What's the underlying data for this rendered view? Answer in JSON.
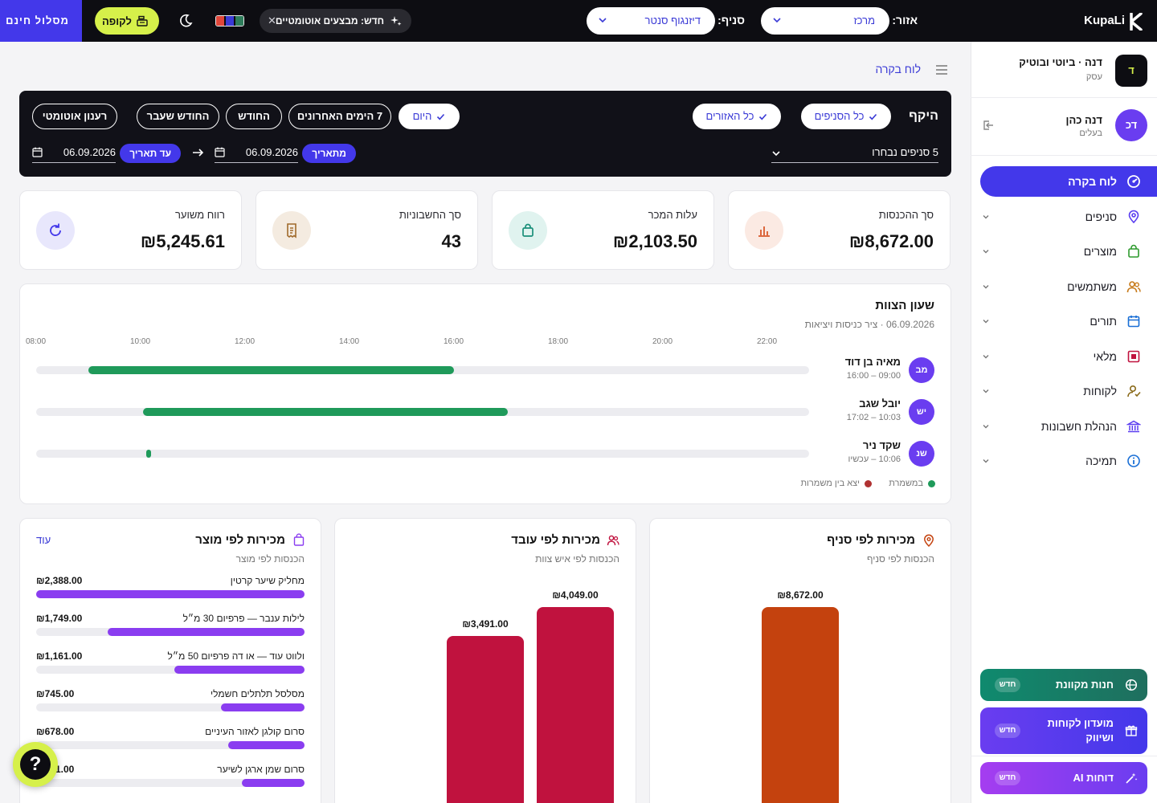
{
  "topbar": {
    "brand": "KupaLi",
    "area_label": "אזור:",
    "area_value": "מרכז",
    "branch_label": "סניף:",
    "branch_value": "דיזנגוף סנטר",
    "news": "חדש: מבצעים אוטומטיים",
    "pos_label": "לקופה",
    "free_track": "מסלול חינם",
    "palette_colors": [
      "#2e7d5b",
      "#3a3ad6",
      "#e0463a"
    ]
  },
  "sidebar": {
    "business": {
      "initial": "ד",
      "name": "דנה · ביוטי ובוטיק",
      "role": "עסק"
    },
    "user": {
      "initials": "דכ",
      "name": "דנה כהן",
      "role": "בעלים"
    },
    "nav": [
      {
        "label": "לוח בקרה",
        "icon": "dashboard-icon",
        "active": true
      },
      {
        "label": "סניפים",
        "icon": "map-pin-icon"
      },
      {
        "label": "מוצרים",
        "icon": "shopping-bag-icon"
      },
      {
        "label": "משתמשים",
        "icon": "users-icon"
      },
      {
        "label": "תורים",
        "icon": "calendar-icon"
      },
      {
        "label": "מלאי",
        "icon": "inventory-icon"
      },
      {
        "label": "לקוחות",
        "icon": "customer-icon"
      },
      {
        "label": "הנהלת חשבונות",
        "icon": "bank-icon"
      },
      {
        "label": "תמיכה",
        "icon": "info-icon"
      }
    ],
    "promos": [
      {
        "label": "חנות מקוונת",
        "badge": "חדש",
        "icon": "globe-icon",
        "color": "#15806b"
      },
      {
        "label": "מועדון לקוחות ושיווק",
        "badge": "חדש",
        "icon": "gift-icon",
        "color": "#5a3df0"
      },
      {
        "label": "דוחות AI",
        "badge": "חדש",
        "icon": "magic-wand-icon",
        "color": "#8a3df0"
      }
    ]
  },
  "breadcrumb": "לוח בקרה",
  "scope": {
    "title": "היקף",
    "branch_chip": "כל הסניפים",
    "area_chip": "כל האזורים",
    "branches_selected": "5 סניפים נבחרו",
    "range_chips": [
      "היום",
      "7 הימים האחרונים",
      "החודש",
      "החודש שעבר",
      "רענון אוטומטי"
    ],
    "from_label": "מתאריך",
    "from_value": "06.09.2026",
    "to_label": "עד תאריך",
    "to_value": "06.09.2026"
  },
  "kpis": [
    {
      "label": "סך ההכנסות",
      "value": "₪8,672.00",
      "icon": "bar-chart-icon",
      "color": "#d9592b",
      "bg": "#fbeae3"
    },
    {
      "label": "עלות המכר",
      "value": "₪2,103.50",
      "icon": "shopping-bag-icon",
      "color": "#1a8f7a",
      "bg": "#e0f3ef"
    },
    {
      "label": "סך החשבוניות",
      "value": "43",
      "icon": "receipt-icon",
      "color": "#a06a2b",
      "bg": "#f4ebe0"
    },
    {
      "label": "רווח משוער",
      "value": "₪5,245.61",
      "icon": "refresh-icon",
      "color": "#4338ea",
      "bg": "#e8e7fc"
    }
  ],
  "timeclock": {
    "title": "שעון הצוות",
    "subtitle": "06.09.2026 · ציר כניסות ויציאות",
    "axis_start_hour": 8,
    "axis_end_hour": 22.8,
    "ticks": [
      "08:00",
      "10:00",
      "12:00",
      "14:00",
      "16:00",
      "18:00",
      "20:00",
      "22:00"
    ],
    "employees": [
      {
        "initials": "מב",
        "name": "מאיה בן דוד",
        "time": "09:00 – 16:00",
        "start": 9.0,
        "end": 16.0
      },
      {
        "initials": "יש",
        "name": "יובל שגב",
        "time": "10:03 – 17:02",
        "start": 10.05,
        "end": 17.03
      },
      {
        "initials": "שנ",
        "name": "שקד ניר",
        "time": "10:06 – עכשיו",
        "start": 10.1,
        "end": 10.15
      }
    ],
    "legend": [
      {
        "label": "במשמרת",
        "color": "#1f9a5a"
      },
      {
        "label": "יצא בין משמרות",
        "color": "#b03232"
      }
    ]
  },
  "sales_by_branch": {
    "title": "מכירות לפי סניף",
    "subtitle": "הכנסות לפי סניף",
    "chart_data": {
      "type": "bar",
      "values": [
        8672.0
      ],
      "value_labels": [
        "₪8,672.00"
      ],
      "colors": [
        "#c4420e"
      ]
    }
  },
  "sales_by_employee": {
    "title": "מכירות לפי עובד",
    "subtitle": "הכנסות לפי איש צוות",
    "chart_data": {
      "type": "bar",
      "values": [
        4049.0,
        3491.0
      ],
      "value_labels": [
        "₪4,049.00",
        "₪3,491.00"
      ],
      "colors": [
        "#c0123e",
        "#c0123e"
      ]
    }
  },
  "sales_by_product": {
    "title": "מכירות לפי מוצר",
    "subtitle": "הכנסות לפי מוצר",
    "more": "עוד",
    "items": [
      {
        "name": "מחליק שיער קרטין",
        "value": "₪2,388.00",
        "amount": 2388.0
      },
      {
        "name": "לילות ענבר — פרפיום 30 מ״ל",
        "value": "₪1,749.00",
        "amount": 1749.0
      },
      {
        "name": "ולווט עוד — או דה פרפיום 50 מ״ל",
        "value": "₪1,161.00",
        "amount": 1161.0
      },
      {
        "name": "מסלסל תלתלים חשמלי",
        "value": "₪745.00",
        "amount": 745.0
      },
      {
        "name": "סרום קולגן לאזור העיניים",
        "value": "₪678.00",
        "amount": 678.0
      },
      {
        "name": "סרום שמן ארגן לשיער",
        "value": "₪561.00",
        "amount": 561.0
      }
    ]
  }
}
